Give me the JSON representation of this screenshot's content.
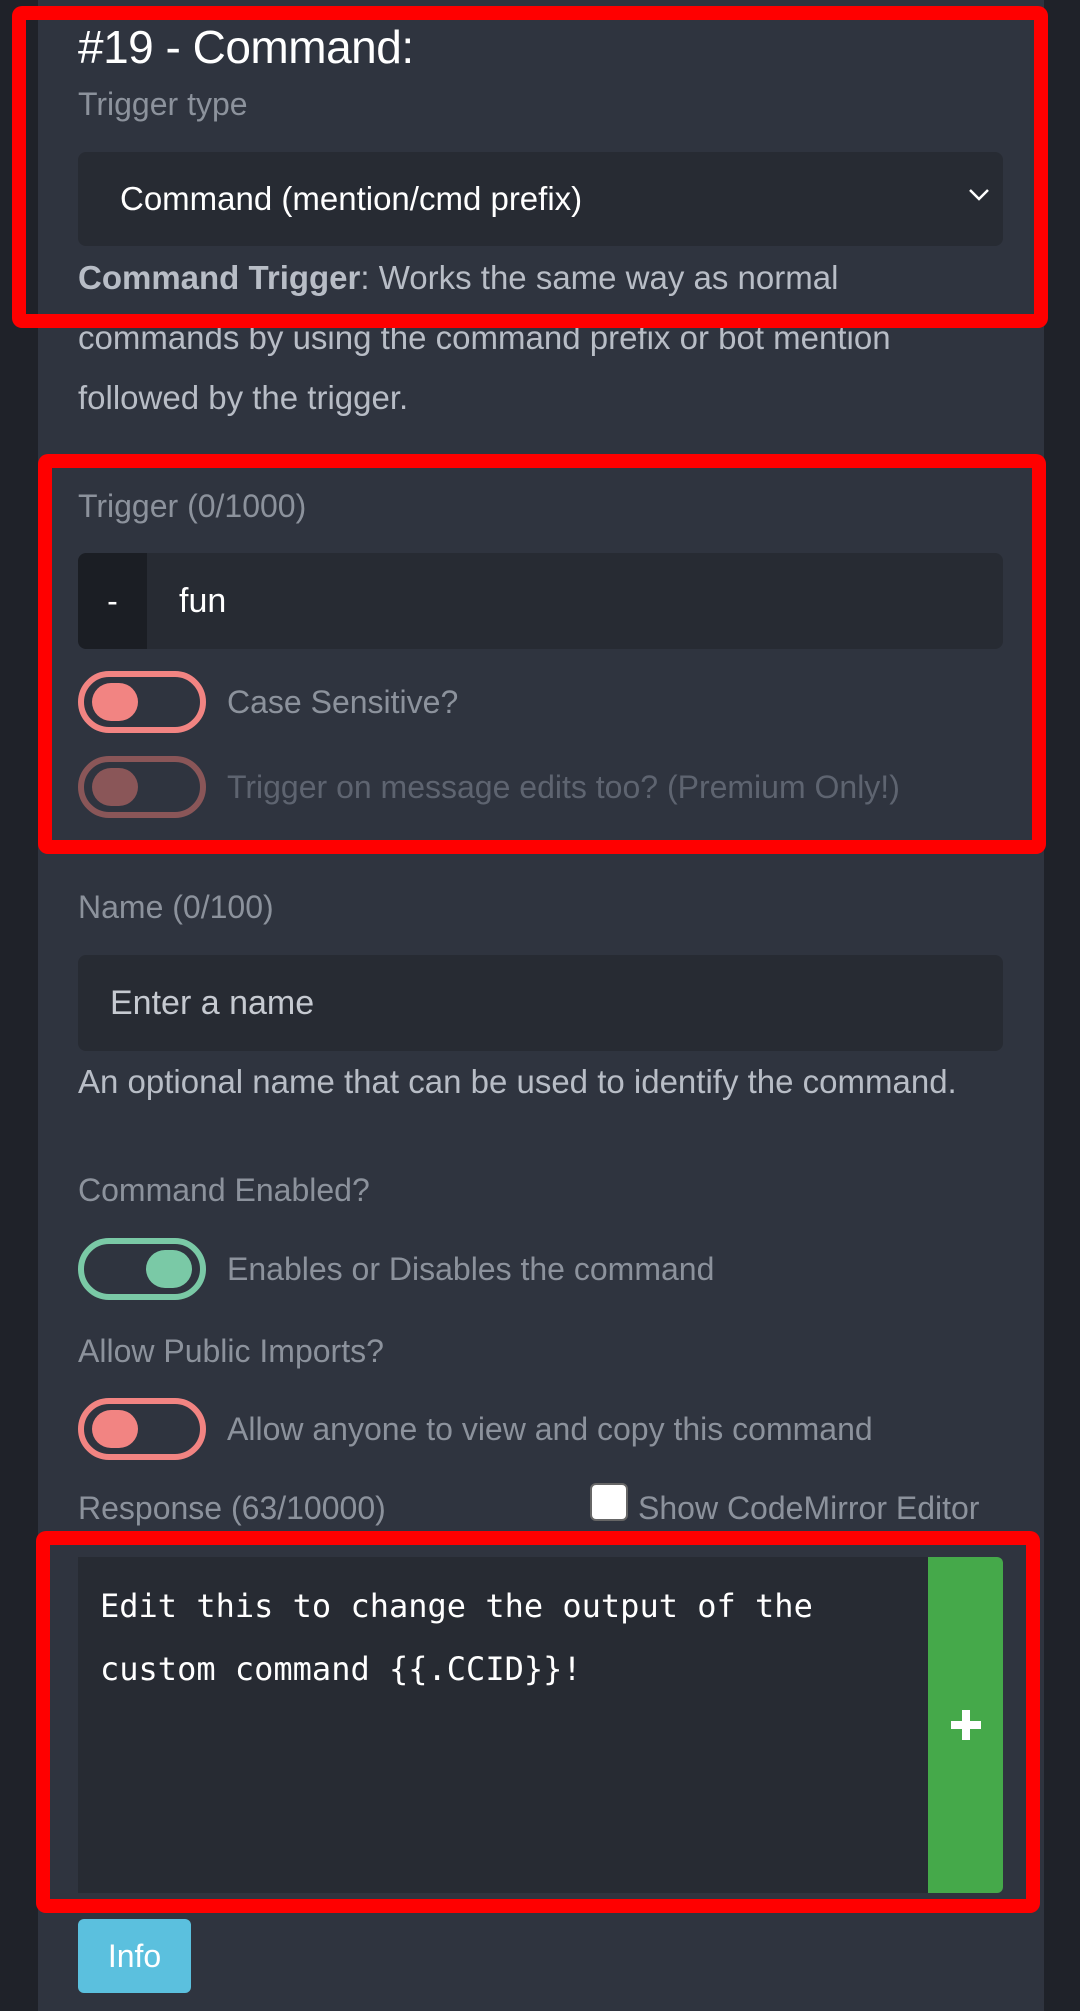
{
  "command": {
    "title": "#19 - Command:"
  },
  "trigger_type": {
    "label": "Trigger type",
    "selected": "Command (mention/cmd prefix)",
    "description_bold": "Command Trigger",
    "description_text": ": Works the same way as normal commands by using the command prefix or bot mention followed by the trigger."
  },
  "trigger": {
    "label": "Trigger (0/1000)",
    "prefix": "-",
    "value": "fun",
    "case_sensitive_label": "Case Sensitive?",
    "edits_label": "Trigger on message edits too? (Premium Only!)"
  },
  "name": {
    "label": "Name (0/100)",
    "placeholder": "Enter a name",
    "help": "An optional name that can be used to identify the command."
  },
  "enabled": {
    "label": "Command Enabled?",
    "toggle_label": "Enables or Disables the command"
  },
  "public_imports": {
    "label": "Allow Public Imports?",
    "toggle_label": "Allow anyone to view and copy this command"
  },
  "response": {
    "label": "Response (63/10000)",
    "codemirror_label": "Show CodeMirror Editor",
    "text": "Edit this to change the output of the\ncustom command {{.CCID}}!",
    "add_symbol": "+"
  },
  "info_button": "Info",
  "colors": {
    "highlight": "#ff0000",
    "toggle_off": "#f28482",
    "toggle_on": "#7ac9a6",
    "add_button": "#45a94a",
    "info_button": "#5bc0de"
  }
}
